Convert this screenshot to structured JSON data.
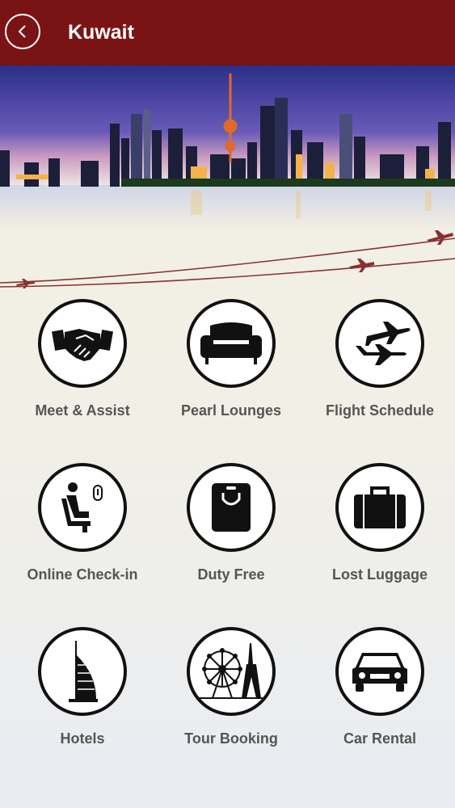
{
  "header": {
    "title": "Kuwait",
    "back_icon": "chevron-left-icon"
  },
  "colors": {
    "header_bg": "#7a1414",
    "accent_line": "#8a3030",
    "icon": "#111111",
    "label": "#555555"
  },
  "tiles": [
    {
      "label": "Meet & Assist",
      "icon": "handshake-icon"
    },
    {
      "label": "Pearl Lounges",
      "icon": "sofa-icon"
    },
    {
      "label": "Flight Schedule",
      "icon": "airplanes-icon"
    },
    {
      "label": "Online Check-in",
      "icon": "seat-checkin-icon"
    },
    {
      "label": "Duty Free",
      "icon": "shopping-bag-icon"
    },
    {
      "label": "Lost Luggage",
      "icon": "suitcase-icon"
    },
    {
      "label": "Hotels",
      "icon": "burj-hotel-icon"
    },
    {
      "label": "Tour Booking",
      "icon": "ferris-wheel-eiffel-icon"
    },
    {
      "label": "Car Rental",
      "icon": "car-icon"
    }
  ]
}
